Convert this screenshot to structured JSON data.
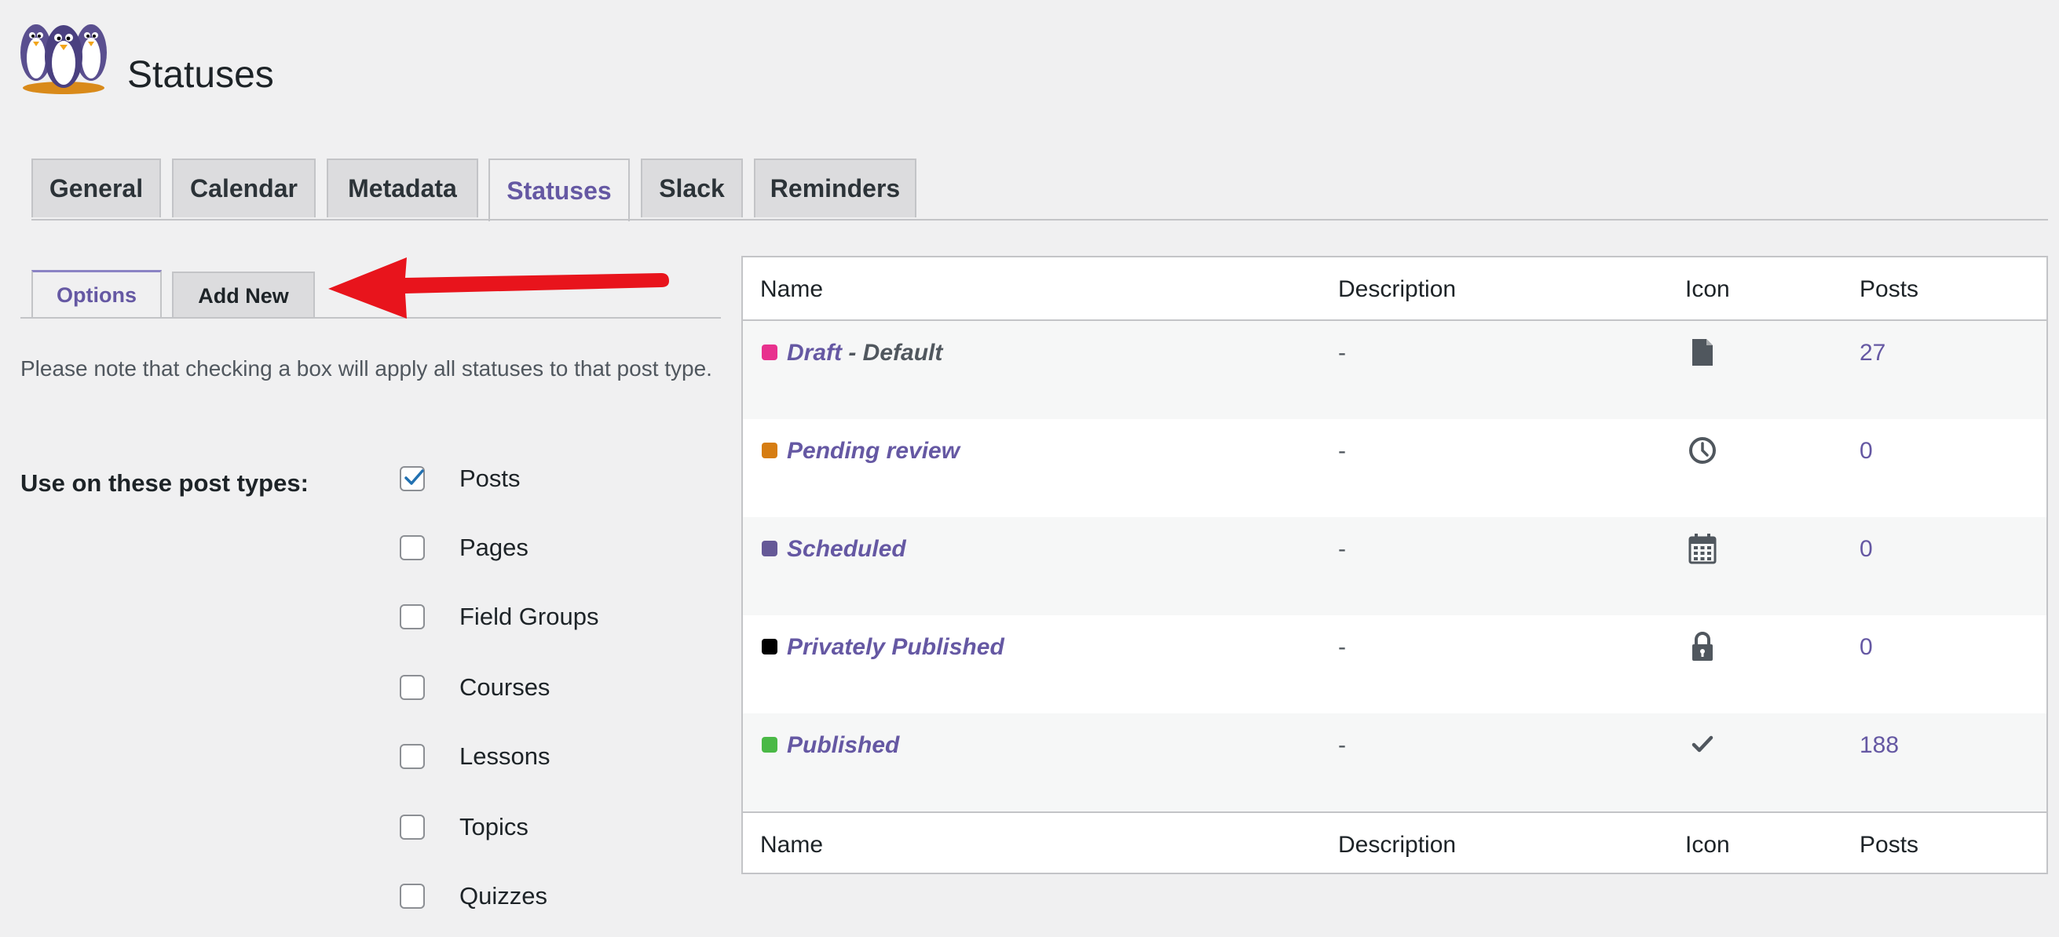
{
  "header": {
    "title": "Statuses"
  },
  "main_tabs": [
    {
      "label": "General"
    },
    {
      "label": "Calendar"
    },
    {
      "label": "Metadata"
    },
    {
      "label": "Statuses",
      "active": true
    },
    {
      "label": "Slack"
    },
    {
      "label": "Reminders"
    }
  ],
  "sub_tabs": {
    "options": "Options",
    "add_new": "Add New"
  },
  "options": {
    "note": "Please note that checking a box will apply all statuses to that post type.",
    "post_types_label": "Use on these post types:",
    "post_types": [
      {
        "label": "Posts",
        "checked": true
      },
      {
        "label": "Pages",
        "checked": false
      },
      {
        "label": "Field Groups",
        "checked": false
      },
      {
        "label": "Courses",
        "checked": false
      },
      {
        "label": "Lessons",
        "checked": false
      },
      {
        "label": "Topics",
        "checked": false
      },
      {
        "label": "Quizzes",
        "checked": false
      }
    ]
  },
  "table": {
    "columns": [
      "Name",
      "Description",
      "Icon",
      "Posts"
    ],
    "rows": [
      {
        "name": "Draft",
        "suffix": " - Default",
        "color": "#e8318e",
        "description": "-",
        "icon": "document-icon",
        "posts": "27"
      },
      {
        "name": "Pending review",
        "suffix": "",
        "color": "#d67d12",
        "description": "-",
        "icon": "clock-icon",
        "posts": "0"
      },
      {
        "name": "Scheduled",
        "suffix": "",
        "color": "#655997",
        "description": "-",
        "icon": "calendar-icon",
        "posts": "0"
      },
      {
        "name": "Privately Published",
        "suffix": "",
        "color": "#000000",
        "description": "-",
        "icon": "lock-icon",
        "posts": "0"
      },
      {
        "name": "Published",
        "suffix": "",
        "color": "#4ab946",
        "description": "-",
        "icon": "checkmark-icon",
        "posts": "188"
      }
    ]
  },
  "colors": {
    "accent": "#6558a3",
    "arrow": "#e8141c"
  }
}
